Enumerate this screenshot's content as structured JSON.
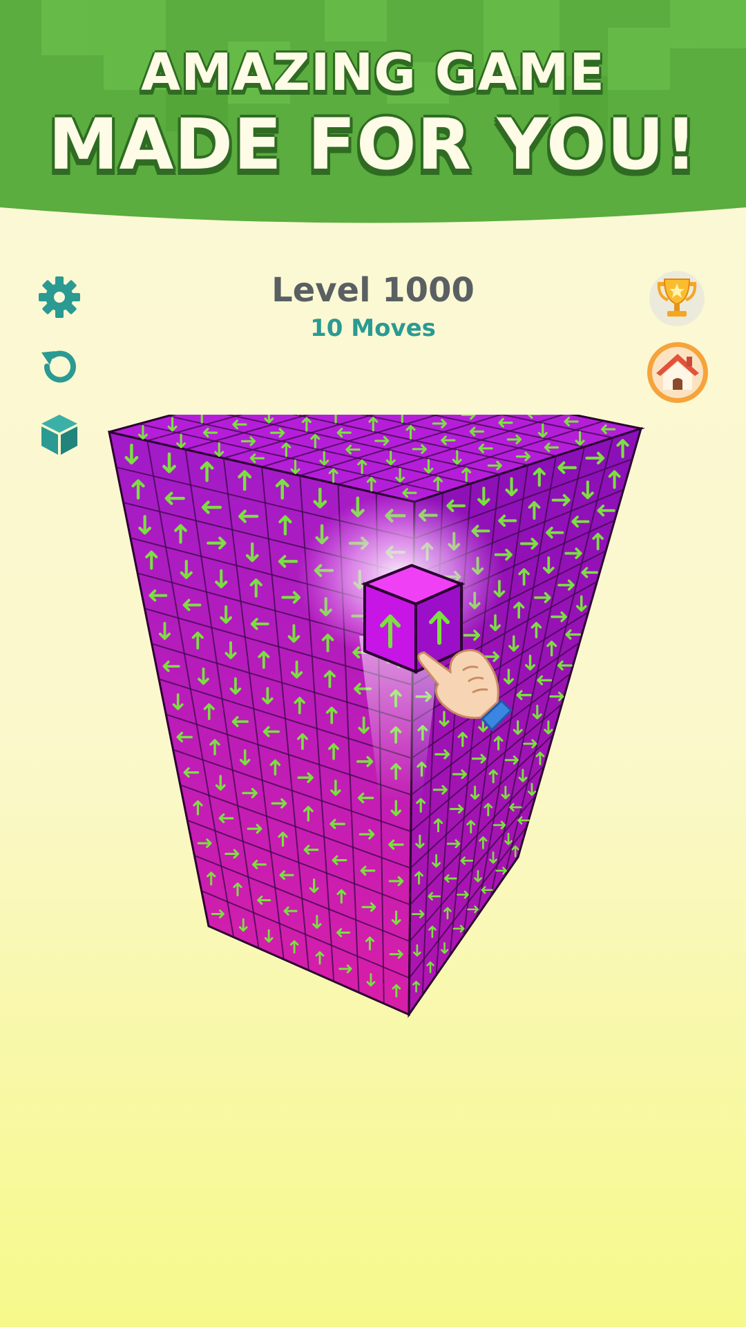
{
  "promo": {
    "line1": "AMAZING GAME",
    "line2": "MADE FOR YOU!"
  },
  "hud": {
    "level": "Level 1000",
    "moves": "10 Moves"
  },
  "icons": {
    "settings": "gear-icon",
    "undo": "undo-icon",
    "view": "cube-icon",
    "trophy": "trophy-icon",
    "home": "home-icon",
    "hand": "pointing-hand-icon"
  },
  "colors": {
    "banner": "#5aad3e",
    "cube_top": "#b51ed8",
    "cube_left": "#9a16c4",
    "cube_right": "#7e0fa8",
    "arrow": "#7be040",
    "highlight_block": "#e020f0",
    "accent_teal": "#2a9a92",
    "level_text": "#5a6062",
    "home_button": "#f6a33a"
  }
}
